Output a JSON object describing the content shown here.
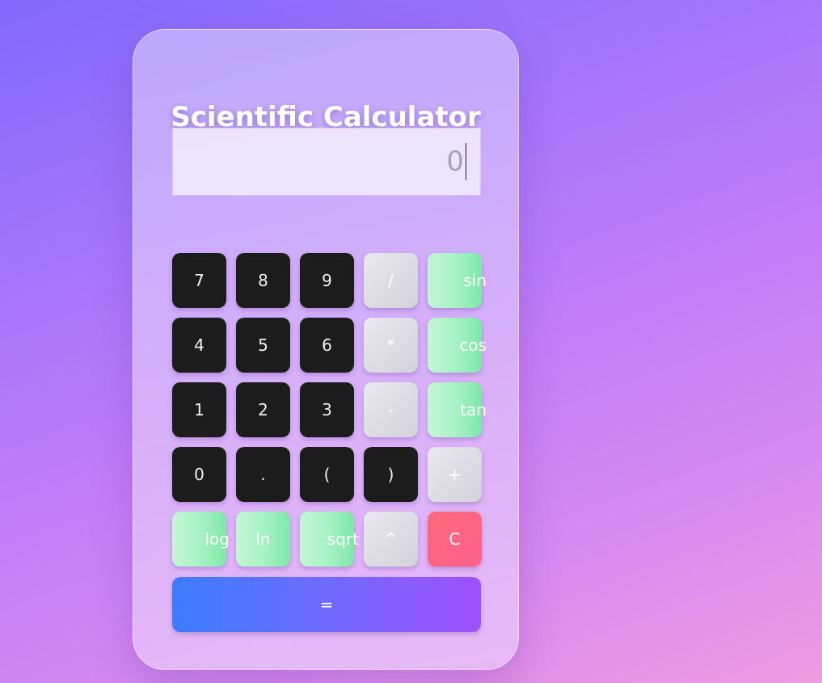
{
  "calculator": {
    "title": "Scientific Calculator",
    "display": {
      "value": "0"
    },
    "rows": [
      [
        {
          "label": "7",
          "style": "dark"
        },
        {
          "label": "8",
          "style": "dark"
        },
        {
          "label": "9",
          "style": "dark"
        },
        {
          "label": "/",
          "style": "gray"
        },
        {
          "label": "sin",
          "style": "green"
        }
      ],
      [
        {
          "label": "4",
          "style": "dark"
        },
        {
          "label": "5",
          "style": "dark"
        },
        {
          "label": "6",
          "style": "dark"
        },
        {
          "label": "*",
          "style": "gray"
        },
        {
          "label": "cos",
          "style": "green"
        }
      ],
      [
        {
          "label": "1",
          "style": "dark"
        },
        {
          "label": "2",
          "style": "dark"
        },
        {
          "label": "3",
          "style": "dark"
        },
        {
          "label": "-",
          "style": "gray"
        },
        {
          "label": "tan",
          "style": "green"
        }
      ],
      [
        {
          "label": "0",
          "style": "dark"
        },
        {
          "label": ".",
          "style": "dark"
        },
        {
          "label": "(",
          "style": "dark"
        },
        {
          "label": ")",
          "style": "dark"
        },
        {
          "label": "+",
          "style": "gray"
        }
      ],
      [
        {
          "label": "log",
          "style": "green"
        },
        {
          "label": "ln",
          "style": "green"
        },
        {
          "label": "sqrt",
          "style": "green"
        },
        {
          "label": "^",
          "style": "gray"
        },
        {
          "label": "C",
          "style": "red"
        }
      ]
    ],
    "equals_label": "="
  },
  "colors": {
    "number_key": "#1c1c1c",
    "operator_key": "#e0dfe6",
    "function_key": "#a6f1c4",
    "clear_key": "#ff6478",
    "equals_start": "#3b7dff",
    "equals_end": "#a050ff"
  }
}
